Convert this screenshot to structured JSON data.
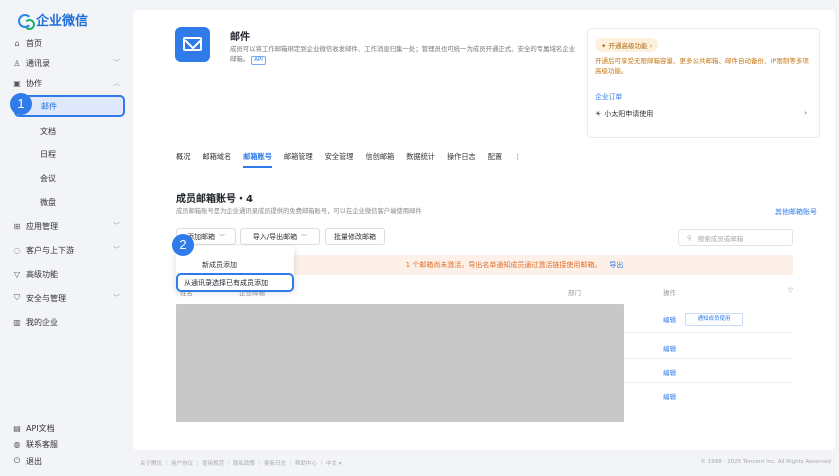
{
  "brand": {
    "name": "企业微信"
  },
  "sidebar": {
    "items": [
      {
        "label": "首页",
        "icon": "home-icon"
      },
      {
        "label": "通讯录",
        "icon": "contacts-icon"
      },
      {
        "label": "协作",
        "icon": "collab-icon"
      }
    ],
    "sub_items": [
      "邮件",
      "文档",
      "日程",
      "会议",
      "微盘"
    ],
    "items2": [
      {
        "label": "应用管理",
        "icon": "apps-icon"
      },
      {
        "label": "客户与上下游",
        "icon": "customer-icon"
      },
      {
        "label": "高级功能",
        "icon": "advanced-icon"
      },
      {
        "label": "安全与管理",
        "icon": "security-icon"
      },
      {
        "label": "我的企业",
        "icon": "company-icon"
      }
    ],
    "bottom": [
      {
        "label": "API文档",
        "icon": "doc-icon"
      },
      {
        "label": "联系客服",
        "icon": "support-icon"
      },
      {
        "label": "退出",
        "icon": "logout-icon"
      }
    ]
  },
  "badges": [
    "1",
    "2"
  ],
  "app": {
    "title": "邮件",
    "desc": "成员可以将工作邮箱绑定到企业微信收发邮件、工作消息归集一处；管理员也可统一为成员开通正式、安全的专属域名企业邮箱。",
    "api_tag": "API"
  },
  "promo": {
    "tag": "开通高级功能",
    "desc": "开通后可享受无限邮箱容量、更多公共邮箱、邮件自动备份、IP限制等多项高级功能。",
    "link": "企业订单",
    "item": "小太阳申请使用"
  },
  "tabs": [
    "概况",
    "邮箱域名",
    "邮箱账号",
    "邮箱管理",
    "安全管理",
    "信创邮箱",
    "数据统计",
    "操作日志",
    "配置",
    "⋮"
  ],
  "section": {
    "title": "成员邮箱账号・4",
    "desc": "成员邮箱账号是为企业通讯录成员提供的免费邮箱账号，可以在企业微信客户端使用邮件",
    "other_link": "其他邮箱账号"
  },
  "toolbar": {
    "add": "添加邮箱",
    "import": "导入/导出邮箱",
    "batch": "批量修改邮箱",
    "search_placeholder": "搜索成员或邮箱"
  },
  "alert": {
    "text": "1 个邮箱尚未激活，导出名单通知成员通过激活链接使用邮箱。",
    "export": "导出"
  },
  "table": {
    "headers": [
      "姓名",
      "企业邮箱",
      "部门",
      "操作"
    ],
    "actions": [
      "编辑",
      "编辑",
      "编辑",
      "编辑"
    ],
    "notify": "通知成员使用"
  },
  "dropdown": {
    "item1": "新成员添加",
    "item2": "从通讯录选择已有成员添加"
  },
  "footer": {
    "links": "关于腾讯 ｜ 用户协议 ｜ 使用规范 ｜ 隐私政策 ｜ 更新日志 ｜ 帮助中心 ｜ 中文 ▾",
    "copyright": "© 1998 - 2025 Tencent Inc. All Rights Reserved"
  }
}
